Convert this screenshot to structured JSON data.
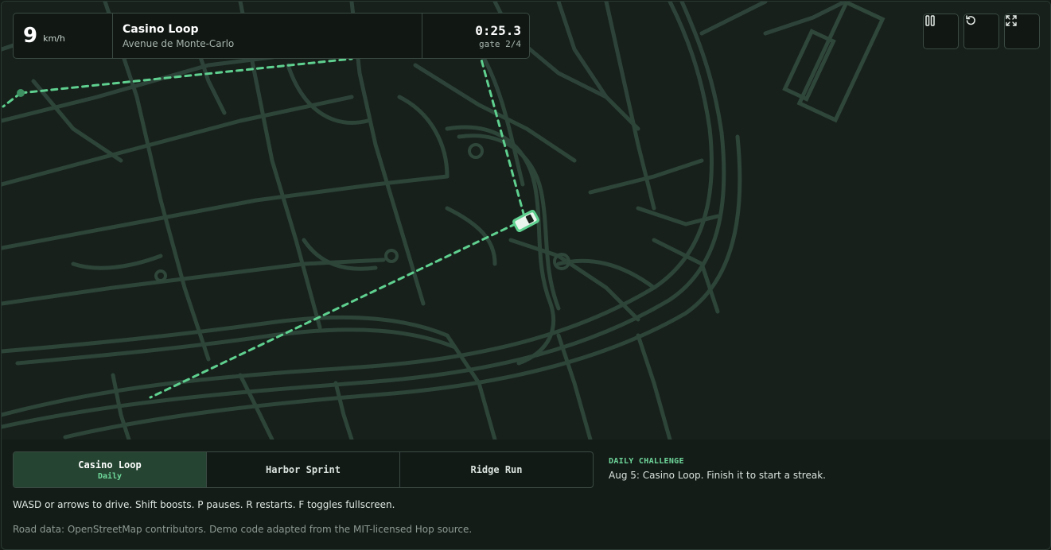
{
  "hud": {
    "speed": "9",
    "speed_unit": "km/h",
    "route_name": "Casino Loop",
    "street": "Avenue de Monte-Carlo",
    "timer": "0:25.3",
    "gate": "gate 2/4"
  },
  "controls": [
    {
      "name": "pause",
      "icon": "pause-icon"
    },
    {
      "name": "restart",
      "icon": "restart-icon"
    },
    {
      "name": "fullscreen",
      "icon": "fullscreen-icon"
    }
  ],
  "tabs": [
    {
      "label": "Casino Loop",
      "sub": "Daily",
      "active": true
    },
    {
      "label": "Harbor Sprint",
      "sub": "",
      "active": false
    },
    {
      "label": "Ridge Run",
      "sub": "",
      "active": false
    }
  ],
  "daily": {
    "title": "DAILY CHALLENGE",
    "text": "Aug 5: Casino Loop. Finish it to start a streak."
  },
  "help_text": "WASD or arrows to drive. Shift boosts. P pauses. R restarts. F toggles fullscreen.",
  "credits": "Road data: OpenStreetMap contributors. Demo code adapted from the MIT-licensed Hop source.",
  "colors": {
    "background": "#141c18",
    "road": "#3b5247",
    "accent": "#6fd89b",
    "route_line": "#5fd08f"
  }
}
